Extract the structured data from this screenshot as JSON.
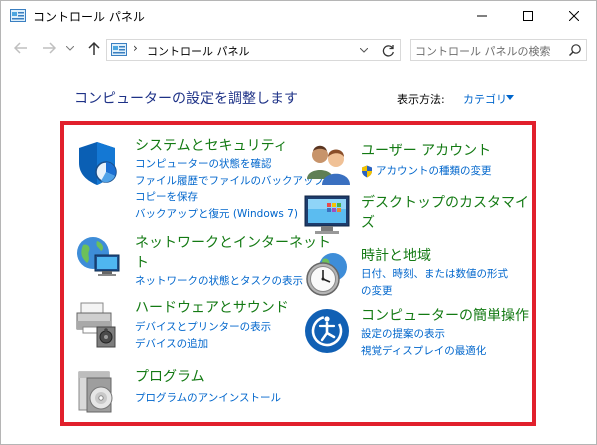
{
  "window": {
    "title": "コントロール パネル"
  },
  "address": {
    "crumb": "コントロール パネル",
    "search_placeholder": "コントロール パネルの検索"
  },
  "header": {
    "title": "コンピューターの設定を調整します",
    "view_by_label": "表示方法:",
    "view_by_value": "カテゴリ"
  },
  "categories": [
    {
      "title": "システムとセキュリティ",
      "links": [
        "コンピューターの状態を確認",
        "ファイル履歴でファイルのバックアップ",
        "コピーを保存",
        "バックアップと復元 (Windows 7)"
      ]
    },
    {
      "title": "ネットワークとインターネット",
      "title_wrap": "ト",
      "links": [
        "ネットワークの状態とタスクの表示"
      ]
    },
    {
      "title": "ハードウェアとサウンド",
      "links": [
        "デバイスとプリンターの表示",
        "デバイスの追加"
      ]
    },
    {
      "title": "プログラム",
      "links": [
        "プログラムのアンインストール"
      ]
    },
    {
      "title": "ユーザー アカウント",
      "links": [
        "アカウントの種類の変更"
      ]
    },
    {
      "title": "デスクトップのカスタマイ",
      "title_wrap": "ズ",
      "links": []
    },
    {
      "title": "時計と地域",
      "links": [
        "日付、時刻、または数値の形式",
        "の変更"
      ]
    },
    {
      "title": "コンピューターの簡単操作",
      "links": [
        "設定の提案の表示",
        "視覚ディスプレイの最適化"
      ]
    }
  ],
  "colors": {
    "category_title": "#137a13",
    "link": "#0066cc",
    "highlight": "#e1202c",
    "page_title": "#1e3287"
  },
  "icons": [
    "control-panel-icon",
    "back-arrow-icon",
    "forward-arrow-icon",
    "up-arrow-icon",
    "refresh-icon",
    "search-icon",
    "security-shield-icon",
    "network-globe-icon",
    "printer-icon",
    "programs-icon",
    "users-icon",
    "desktop-monitor-icon",
    "clock-globe-icon",
    "ease-of-access-icon"
  ]
}
